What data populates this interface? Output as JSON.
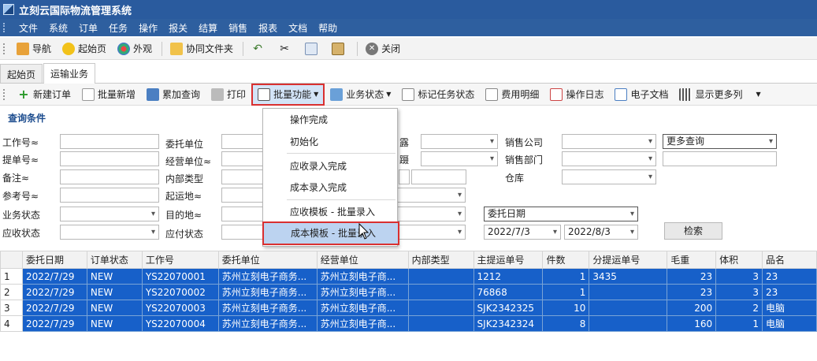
{
  "app": {
    "title": "立刻云国际物流管理系统"
  },
  "menu": [
    "文件",
    "系统",
    "订单",
    "任务",
    "操作",
    "报关",
    "结算",
    "销售",
    "报表",
    "文档",
    "帮助"
  ],
  "toolbar1": [
    {
      "label": "导航",
      "icon": "navigation-icon"
    },
    {
      "label": "起始页",
      "icon": "star-icon"
    },
    {
      "label": "外观",
      "icon": "palette-icon"
    },
    {
      "label": "协同文件夹",
      "icon": "folder-icon"
    },
    {
      "label": "",
      "icon": "undo-icon"
    },
    {
      "label": "",
      "icon": "cut-icon"
    },
    {
      "label": "",
      "icon": "copy-icon"
    },
    {
      "label": "",
      "icon": "paste-icon"
    },
    {
      "label": "关闭",
      "icon": "close-icon"
    }
  ],
  "tabs": [
    "起始页",
    "运输业务"
  ],
  "toolbar2": [
    {
      "label": "新建订单"
    },
    {
      "label": "批量新增"
    },
    {
      "label": "累加查询"
    },
    {
      "label": "打印"
    },
    {
      "label": "批量功能"
    },
    {
      "label": "业务状态"
    },
    {
      "label": "标记任务状态"
    },
    {
      "label": "费用明细"
    },
    {
      "label": "操作日志"
    },
    {
      "label": "电子文档"
    },
    {
      "label": "显示更多列"
    }
  ],
  "query": {
    "title": "查询条件",
    "labels": {
      "job_no": "工作号≈",
      "bl_no": "提单号≈",
      "remark": "备注≈",
      "ref_no": "参考号≈",
      "biz_status": "业务状态",
      "ar_status": "应收状态",
      "consignor": "委托单位",
      "operator_unit": "经营单位≈",
      "internal_type": "内部类型",
      "origin": "起运地≈",
      "destination": "目的地≈",
      "ap_status": "应付状态",
      "sales_company": "销售公司",
      "sales_dept": "销售部门",
      "warehouse": "仓库",
      "partial_c1": "露",
      "partial_c2": "蹑"
    },
    "more_query": "更多查询",
    "date_field": "委托日期",
    "date_from": "2022/7/3",
    "date_to": "2022/8/3",
    "search_button": "检索"
  },
  "dropdown": {
    "items": [
      "操作完成",
      "初始化",
      "应收录入完成",
      "成本录入完成",
      "应收模板 - 批量录入",
      "成本模板 - 批量录入"
    ]
  },
  "grid": {
    "columns": [
      "",
      "委托日期",
      "订单状态",
      "工作号",
      "委托单位",
      "经营单位",
      "内部类型",
      "主提运单号",
      "件数",
      "分提运单号",
      "毛重",
      "体积",
      "品名"
    ],
    "rows": [
      [
        "1",
        "2022/7/29",
        "NEW",
        "YS22070001",
        "苏州立刻电子商务...",
        "苏州立刻电子商...",
        "",
        "1212",
        "1",
        "3435",
        "23",
        "3",
        "23"
      ],
      [
        "2",
        "2022/7/29",
        "NEW",
        "YS22070002",
        "苏州立刻电子商务...",
        "苏州立刻电子商...",
        "",
        "76868",
        "1",
        "",
        "23",
        "3",
        "23"
      ],
      [
        "3",
        "2022/7/29",
        "NEW",
        "YS22070003",
        "苏州立刻电子商务...",
        "苏州立刻电子商...",
        "",
        "SJK2342325",
        "10",
        "",
        "200",
        "2",
        "电脑"
      ],
      [
        "4",
        "2022/7/29",
        "NEW",
        "YS22070004",
        "苏州立刻电子商务...",
        "苏州立刻电子商...",
        "",
        "SJK2342324",
        "8",
        "",
        "160",
        "1",
        "电脑"
      ]
    ]
  }
}
